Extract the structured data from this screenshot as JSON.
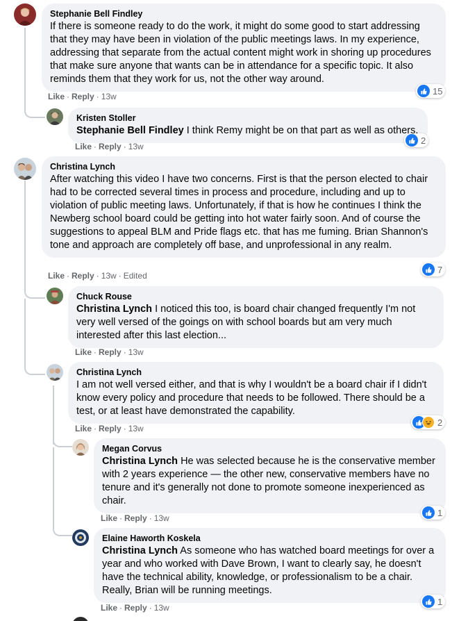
{
  "comments": [
    {
      "author": "Stephanie Bell Findley",
      "mention": "",
      "text": "If there is someone ready to do the work, it might do some good to start addressing that they may have been in violation of the public meetings laws. In my experience, addressing that separate from the actual content might work in shoring up procedures that make sure anyone that wants can be in attendance for a specific topic. It also reminds them that they work for us, not the other way around.",
      "like_label": "Like",
      "reply_label": "Reply",
      "time": "13w",
      "edited": "",
      "reaction_count": "15",
      "avatar_color": "#8a2b2b"
    },
    {
      "author": "Kristen Stoller",
      "mention": "Stephanie Bell Findley",
      "text": " I think Remy might be on that part as well as others.",
      "like_label": "Like",
      "reply_label": "Reply",
      "time": "13w",
      "edited": "",
      "reaction_count": "2",
      "avatar_color": "#6b7a5e"
    },
    {
      "author": "Christina Lynch",
      "mention": "",
      "text": "After watching this video I have two concerns. First is that the person elected to chair had to be corrected several times in process and procedure, including and up to violation of public meeting laws. Unfortunately, if that is how he continues I think the Newberg school board could be getting into hot water fairly soon. And of course the suggestions to appeal BLM and Pride flags etc. that has me fuming. Brian Shannon's tone and approach are completely off base, and unprofessional in any realm.",
      "like_label": "Like",
      "reply_label": "Reply",
      "time": "13w",
      "edited": "Edited",
      "reaction_count": "7",
      "avatar_color": "#9c8a76"
    },
    {
      "author": "Chuck Rouse",
      "mention": "Christina Lynch",
      "text": " I noticed this too, is board chair changed frequently I'm not very well versed of the goings on with school boards but am very much interested after this last election...",
      "like_label": "Like",
      "reply_label": "Reply",
      "time": "13w",
      "edited": "",
      "reaction_count": "",
      "avatar_color": "#5f7d52"
    },
    {
      "author": "Christina Lynch",
      "mention": "",
      "text": "I am not well versed either, and that is why I wouldn't be a board chair if I didn't know every policy and procedure that needs to be followed. There should be a test, or at least have demonstrated the capability.",
      "like_label": "Like",
      "reply_label": "Reply",
      "time": "13w",
      "edited": "",
      "reaction_count": "2",
      "avatar_color": "#9c8a76"
    },
    {
      "author": "Megan Corvus",
      "mention": "Christina Lynch",
      "text": " He was selected because he is the conservative member with 2 years experience — the other new, conservative members have no tenure and it's generally not done to promote someone inexperienced as chair.",
      "like_label": "Like",
      "reply_label": "Reply",
      "time": "13w",
      "edited": "",
      "reaction_count": "1",
      "avatar_color": "#b48d6a"
    },
    {
      "author": "Elaine Haworth Koskela",
      "mention": "Christina Lynch",
      "text": " As someone who has watched board meetings for over a year and who worked with Dave Brown, I want to clearly say, he doesn't have the technical ability, knowledge, or professionalism to be a chair. Really, Brian will be running meetings.",
      "like_label": "Like",
      "reply_label": "Reply",
      "time": "13w",
      "edited": "",
      "reaction_count": "1",
      "avatar_color": "#233a5e"
    }
  ],
  "colors": {
    "bubble": "#f0f2f5",
    "meta": "#65676b",
    "like_blue": "#1877f2",
    "haha_yellow": "#f7b125"
  },
  "icons": {
    "like": "like-icon",
    "haha": "haha-icon"
  }
}
